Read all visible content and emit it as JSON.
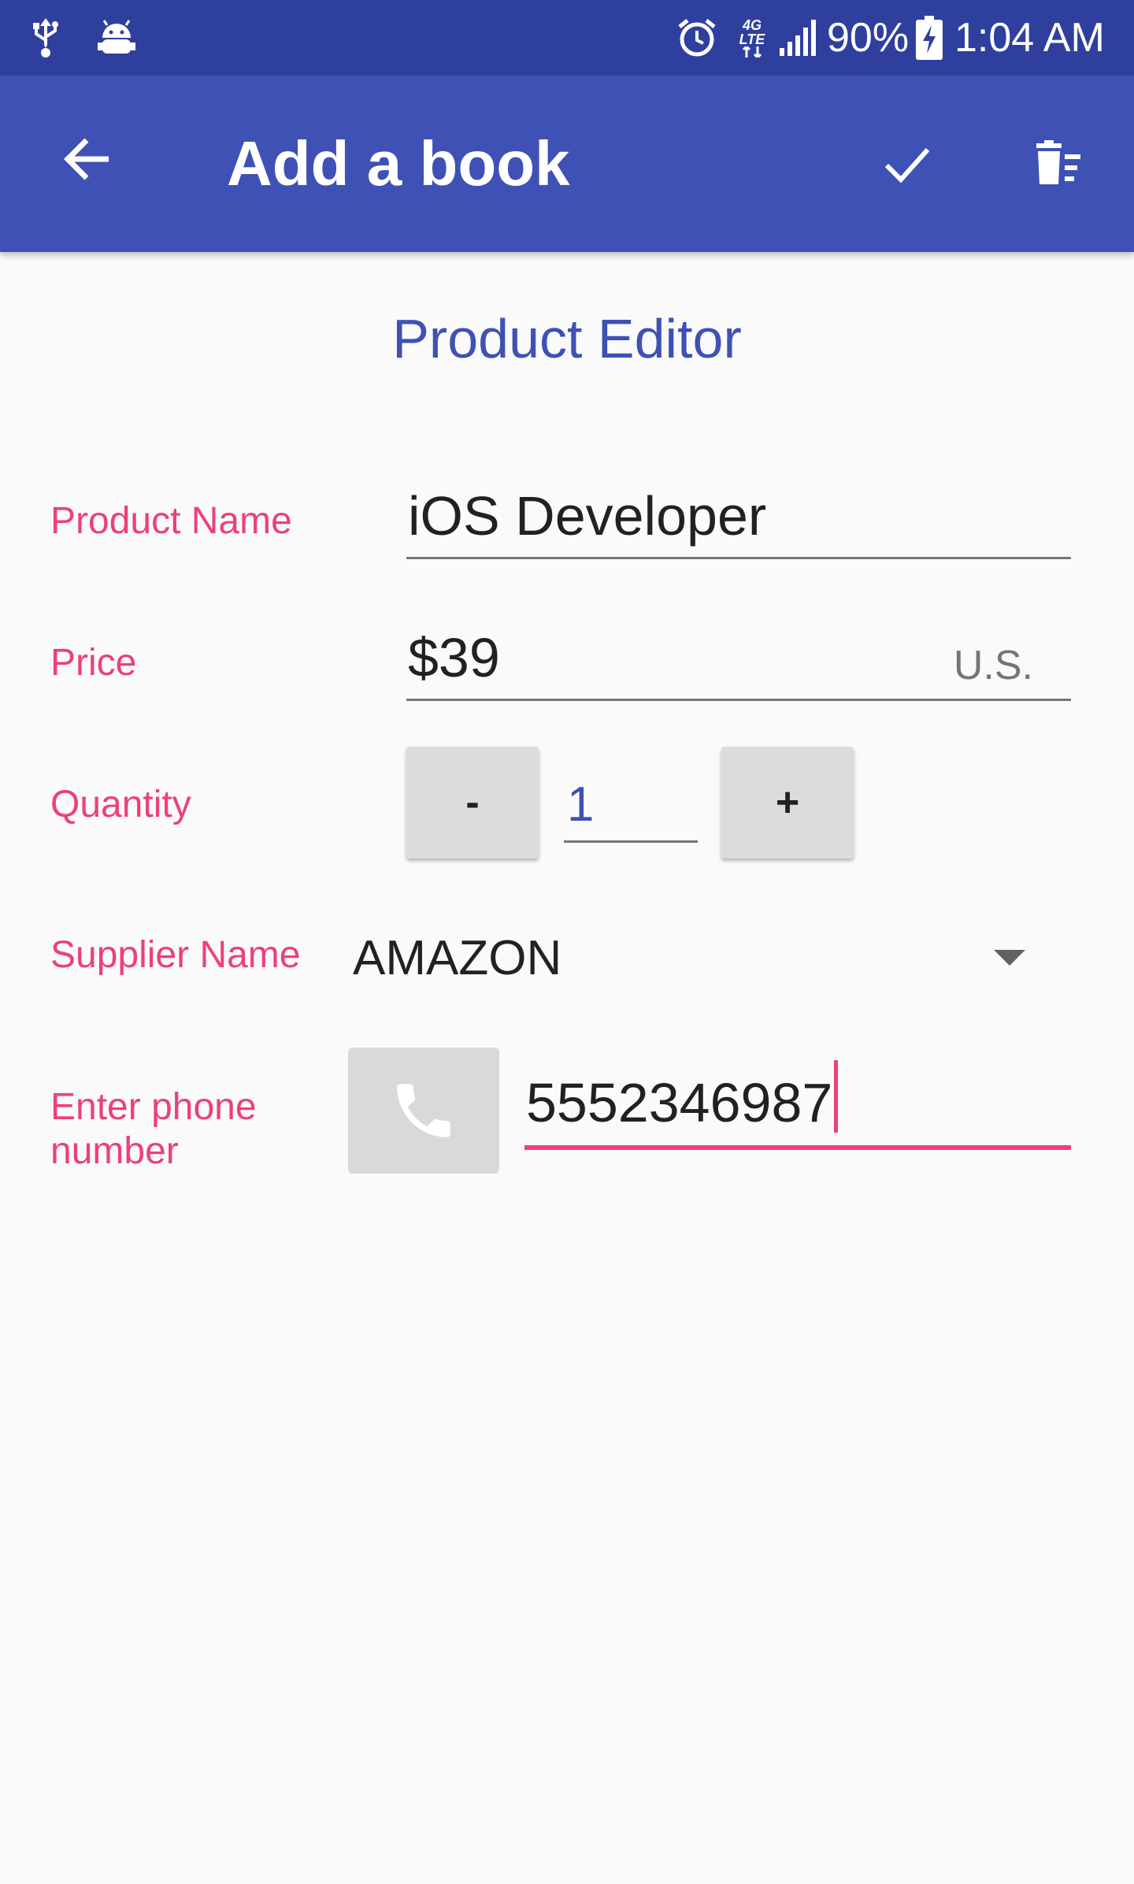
{
  "status_bar": {
    "usb_icon": "usb-icon",
    "android_icon": "android-debug-icon",
    "alarm_icon": "alarm-icon",
    "network_label": "4G LTE",
    "signal_icon": "signal-icon",
    "battery_percent": "90%",
    "battery_icon": "battery-charging-icon",
    "time": "1:04 AM"
  },
  "app_bar": {
    "back_icon": "arrow-left-icon",
    "title": "Add a book",
    "save_icon": "check-icon",
    "delete_icon": "delete-all-icon"
  },
  "editor": {
    "heading": "Product Editor",
    "product_name": {
      "label": "Product Name",
      "value": "iOS Developer"
    },
    "price": {
      "label": "Price",
      "value": "$39",
      "suffix": "U.S."
    },
    "quantity": {
      "label": "Quantity",
      "decrement_label": "-",
      "value": "1",
      "increment_label": "+"
    },
    "supplier": {
      "label": "Supplier Name",
      "selected": "AMAZON"
    },
    "phone": {
      "label_line1": "Enter phone",
      "label_line2": "number",
      "button_icon": "phone-icon",
      "value": "5552346987"
    }
  },
  "colors": {
    "status_bar": "#2f3f9e",
    "app_bar": "#3f51b5",
    "accent": "#ec407a",
    "primary_text": "#212121",
    "background": "#fafafa"
  }
}
